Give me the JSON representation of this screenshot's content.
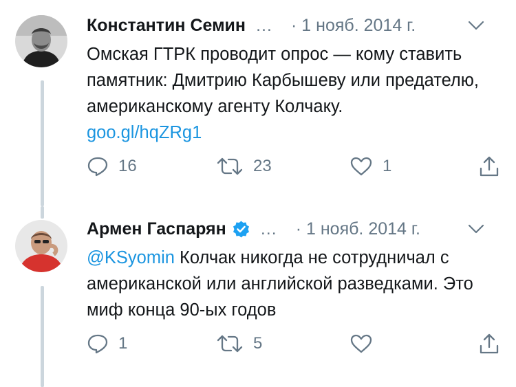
{
  "tweets": [
    {
      "author": "Константин Семин",
      "verified": false,
      "ellipsis": "…",
      "date": "· 1 нояб. 2014 г.",
      "text": "Омская ГТРК проводит опрос — кому ставить памятник: Дмитрию Карбышеву или предателю, американскому агенту Колчаку.",
      "link": "goo.gl/hqZRg1",
      "replies": "16",
      "retweets": "23",
      "likes": "1"
    },
    {
      "author": "Армен Гаспарян",
      "verified": true,
      "ellipsis": "…",
      "date": "· 1 нояб. 2014 г.",
      "mention": "@KSyomin",
      "text": " Колчак никогда не сотрудничал с американской или английской разведками. Это миф конца 90-ых годов",
      "replies": "1",
      "retweets": "5",
      "likes": ""
    }
  ],
  "icons": {
    "reply": "reply-icon",
    "retweet": "retweet-icon",
    "like": "heart-icon",
    "share": "share-icon",
    "more": "chevron-down-icon",
    "verified": "verified-badge-icon"
  },
  "colors": {
    "text": "#14171a",
    "secondary": "#657786",
    "link": "#1b95e0",
    "thread_line": "#ccd6dd",
    "verified": "#1da1f2"
  }
}
